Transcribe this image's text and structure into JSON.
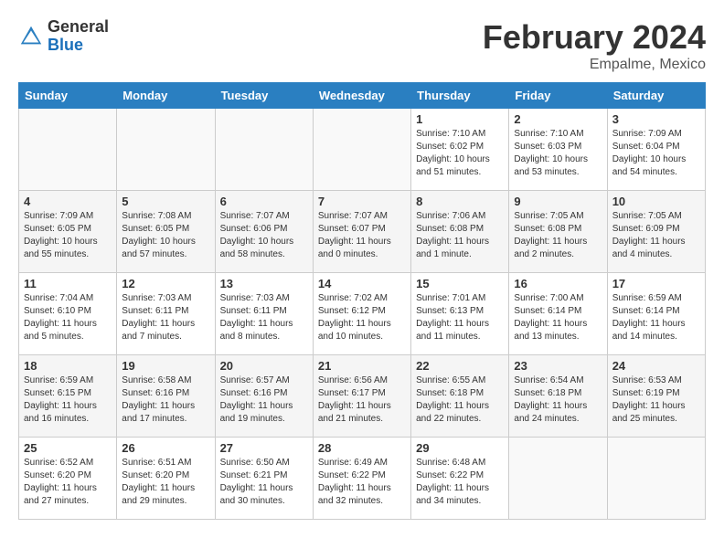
{
  "logo": {
    "general": "General",
    "blue": "Blue"
  },
  "title": "February 2024",
  "subtitle": "Empalme, Mexico",
  "days_of_week": [
    "Sunday",
    "Monday",
    "Tuesday",
    "Wednesday",
    "Thursday",
    "Friday",
    "Saturday"
  ],
  "weeks": [
    [
      {
        "day": "",
        "info": ""
      },
      {
        "day": "",
        "info": ""
      },
      {
        "day": "",
        "info": ""
      },
      {
        "day": "",
        "info": ""
      },
      {
        "day": "1",
        "info": "Sunrise: 7:10 AM\nSunset: 6:02 PM\nDaylight: 10 hours\nand 51 minutes."
      },
      {
        "day": "2",
        "info": "Sunrise: 7:10 AM\nSunset: 6:03 PM\nDaylight: 10 hours\nand 53 minutes."
      },
      {
        "day": "3",
        "info": "Sunrise: 7:09 AM\nSunset: 6:04 PM\nDaylight: 10 hours\nand 54 minutes."
      }
    ],
    [
      {
        "day": "4",
        "info": "Sunrise: 7:09 AM\nSunset: 6:05 PM\nDaylight: 10 hours\nand 55 minutes."
      },
      {
        "day": "5",
        "info": "Sunrise: 7:08 AM\nSunset: 6:05 PM\nDaylight: 10 hours\nand 57 minutes."
      },
      {
        "day": "6",
        "info": "Sunrise: 7:07 AM\nSunset: 6:06 PM\nDaylight: 10 hours\nand 58 minutes."
      },
      {
        "day": "7",
        "info": "Sunrise: 7:07 AM\nSunset: 6:07 PM\nDaylight: 11 hours\nand 0 minutes."
      },
      {
        "day": "8",
        "info": "Sunrise: 7:06 AM\nSunset: 6:08 PM\nDaylight: 11 hours\nand 1 minute."
      },
      {
        "day": "9",
        "info": "Sunrise: 7:05 AM\nSunset: 6:08 PM\nDaylight: 11 hours\nand 2 minutes."
      },
      {
        "day": "10",
        "info": "Sunrise: 7:05 AM\nSunset: 6:09 PM\nDaylight: 11 hours\nand 4 minutes."
      }
    ],
    [
      {
        "day": "11",
        "info": "Sunrise: 7:04 AM\nSunset: 6:10 PM\nDaylight: 11 hours\nand 5 minutes."
      },
      {
        "day": "12",
        "info": "Sunrise: 7:03 AM\nSunset: 6:11 PM\nDaylight: 11 hours\nand 7 minutes."
      },
      {
        "day": "13",
        "info": "Sunrise: 7:03 AM\nSunset: 6:11 PM\nDaylight: 11 hours\nand 8 minutes."
      },
      {
        "day": "14",
        "info": "Sunrise: 7:02 AM\nSunset: 6:12 PM\nDaylight: 11 hours\nand 10 minutes."
      },
      {
        "day": "15",
        "info": "Sunrise: 7:01 AM\nSunset: 6:13 PM\nDaylight: 11 hours\nand 11 minutes."
      },
      {
        "day": "16",
        "info": "Sunrise: 7:00 AM\nSunset: 6:14 PM\nDaylight: 11 hours\nand 13 minutes."
      },
      {
        "day": "17",
        "info": "Sunrise: 6:59 AM\nSunset: 6:14 PM\nDaylight: 11 hours\nand 14 minutes."
      }
    ],
    [
      {
        "day": "18",
        "info": "Sunrise: 6:59 AM\nSunset: 6:15 PM\nDaylight: 11 hours\nand 16 minutes."
      },
      {
        "day": "19",
        "info": "Sunrise: 6:58 AM\nSunset: 6:16 PM\nDaylight: 11 hours\nand 17 minutes."
      },
      {
        "day": "20",
        "info": "Sunrise: 6:57 AM\nSunset: 6:16 PM\nDaylight: 11 hours\nand 19 minutes."
      },
      {
        "day": "21",
        "info": "Sunrise: 6:56 AM\nSunset: 6:17 PM\nDaylight: 11 hours\nand 21 minutes."
      },
      {
        "day": "22",
        "info": "Sunrise: 6:55 AM\nSunset: 6:18 PM\nDaylight: 11 hours\nand 22 minutes."
      },
      {
        "day": "23",
        "info": "Sunrise: 6:54 AM\nSunset: 6:18 PM\nDaylight: 11 hours\nand 24 minutes."
      },
      {
        "day": "24",
        "info": "Sunrise: 6:53 AM\nSunset: 6:19 PM\nDaylight: 11 hours\nand 25 minutes."
      }
    ],
    [
      {
        "day": "25",
        "info": "Sunrise: 6:52 AM\nSunset: 6:20 PM\nDaylight: 11 hours\nand 27 minutes."
      },
      {
        "day": "26",
        "info": "Sunrise: 6:51 AM\nSunset: 6:20 PM\nDaylight: 11 hours\nand 29 minutes."
      },
      {
        "day": "27",
        "info": "Sunrise: 6:50 AM\nSunset: 6:21 PM\nDaylight: 11 hours\nand 30 minutes."
      },
      {
        "day": "28",
        "info": "Sunrise: 6:49 AM\nSunset: 6:22 PM\nDaylight: 11 hours\nand 32 minutes."
      },
      {
        "day": "29",
        "info": "Sunrise: 6:48 AM\nSunset: 6:22 PM\nDaylight: 11 hours\nand 34 minutes."
      },
      {
        "day": "",
        "info": ""
      },
      {
        "day": "",
        "info": ""
      }
    ]
  ]
}
